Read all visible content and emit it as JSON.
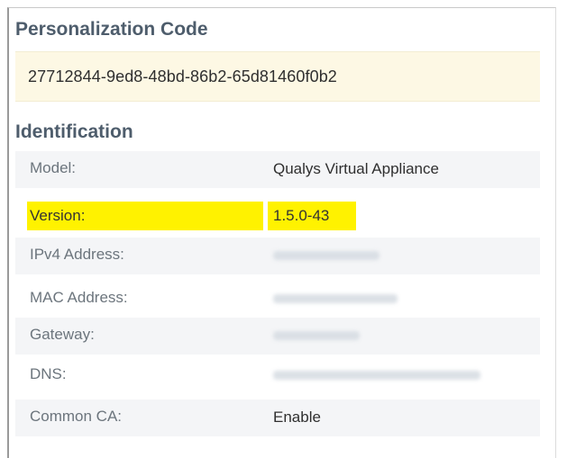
{
  "personalization": {
    "title": "Personalization Code",
    "code": "27712844-9ed8-48bd-86b2-65d81460f0b2"
  },
  "identification": {
    "title": "Identification",
    "rows": [
      {
        "label": "Model:",
        "value": "Qualys Virtual Appliance"
      },
      {
        "label": "Version:",
        "value": "1.5.0-43"
      },
      {
        "label": "IPv4 Address:",
        "value": ""
      },
      {
        "label": "MAC Address:",
        "value": ""
      },
      {
        "label": "Gateway:",
        "value": ""
      },
      {
        "label": "DNS:",
        "value": ""
      },
      {
        "label": "Common CA:",
        "value": "Enable"
      }
    ]
  },
  "colors": {
    "highlight": "#fff200",
    "section_title": "#4e5d6c",
    "code_background": "#fdf8e4"
  }
}
